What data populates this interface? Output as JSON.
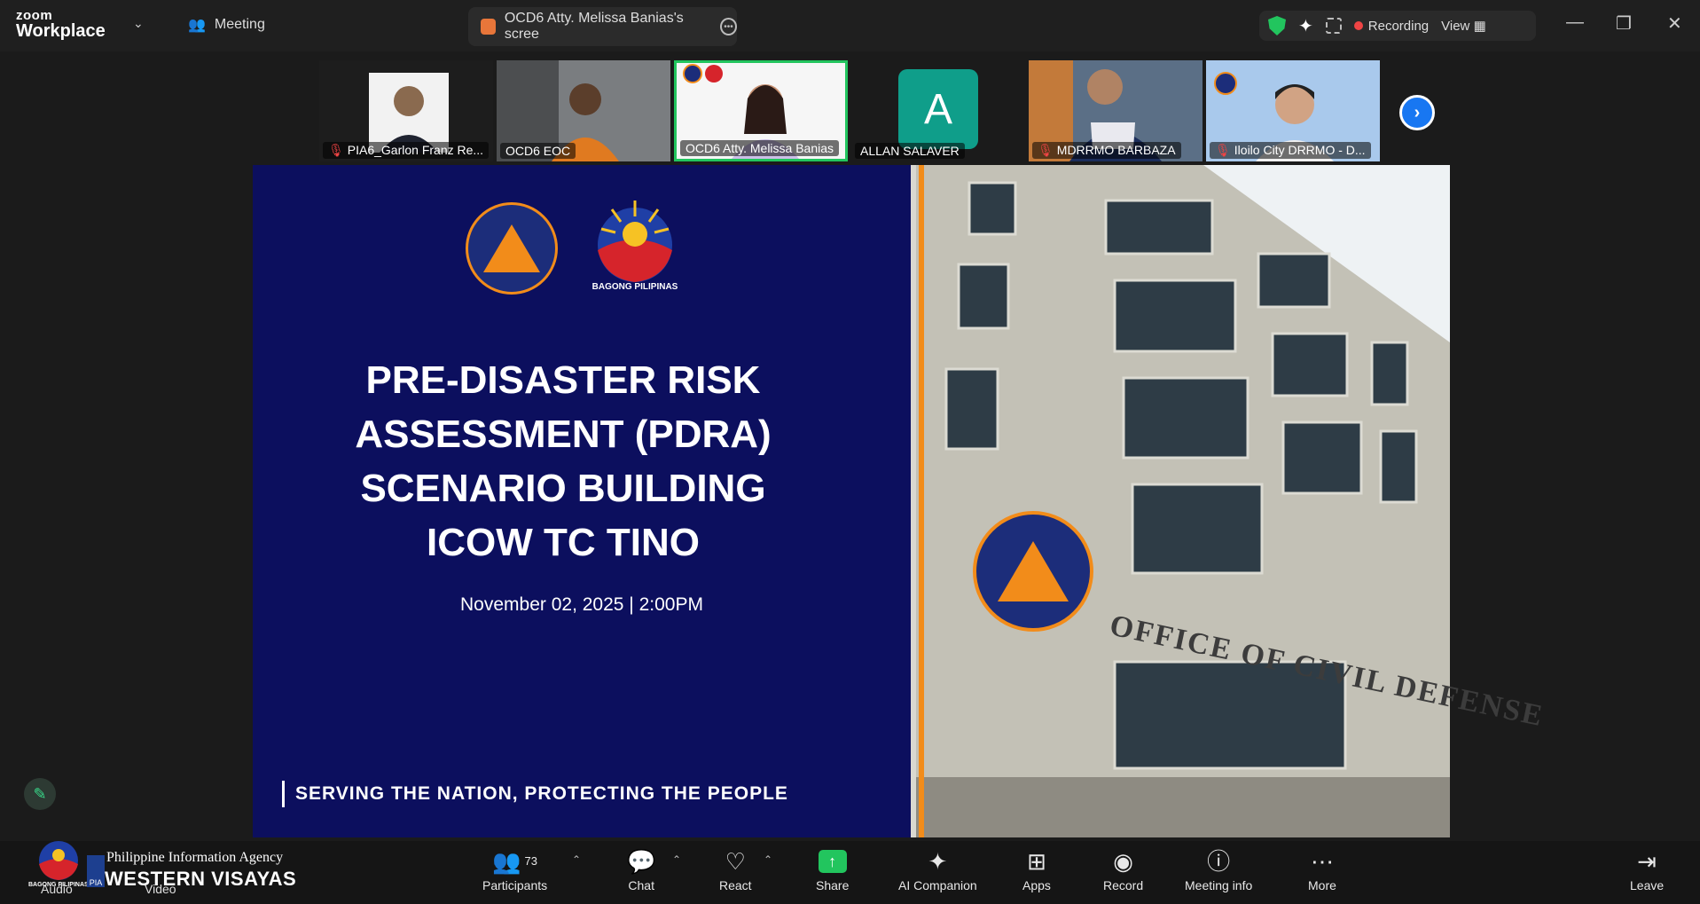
{
  "app": {
    "brand_top": "zoom",
    "brand_bottom": "Workplace",
    "meeting_tab": "Meeting",
    "share_tab_title": "OCD6 Atty. Melissa Banias's scree",
    "recording_label": "Recording",
    "view_label": "View"
  },
  "participants_strip": [
    {
      "name": "PIA6_Garlon Franz Re...",
      "muted": true
    },
    {
      "name": "OCD6 EOC",
      "muted": false
    },
    {
      "name": "OCD6 Atty. Melissa Banias",
      "muted": false,
      "active_speaker": true
    },
    {
      "name": "ALLAN SALAVER",
      "muted": false,
      "avatar_letter": "A"
    },
    {
      "name": "MDRRMO BARBAZA",
      "muted": true
    },
    {
      "name": "Iloilo City DRRMO - D...",
      "muted": true
    }
  ],
  "slide": {
    "logo_caption": "BAGONG PILIPINAS",
    "title_lines": [
      "PRE-DISASTER RISK",
      "ASSESSMENT (PDRA)",
      "SCENARIO BUILDING",
      "ICOW TC TINO"
    ],
    "date_line": "November 02, 2025 | 2:00PM",
    "footer": "SERVING THE NATION, PROTECTING THE PEOPLE",
    "building_sign": "OFFICE OF CIVIL DEFENSE",
    "seal_text": "OCD"
  },
  "toolbar": {
    "participants_count": "73",
    "participants": "Participants",
    "chat": "Chat",
    "react": "React",
    "share": "Share",
    "ai_companion": "AI Companion",
    "apps": "Apps",
    "record": "Record",
    "meeting_info": "Meeting info",
    "more": "More",
    "leave": "Leave",
    "audio": "Audio",
    "video": "Video"
  },
  "watermark": {
    "agency": "Philippine Information Agency",
    "region": "WESTERN VISAYAS",
    "badge": "PIA",
    "small": "BAGONG PILIPINAS"
  },
  "colors": {
    "slide_bg": "#0c0f5e",
    "accent_orange": "#f28c1a",
    "share_green": "#22c55e",
    "avatar_teal": "#0f9e8a"
  }
}
